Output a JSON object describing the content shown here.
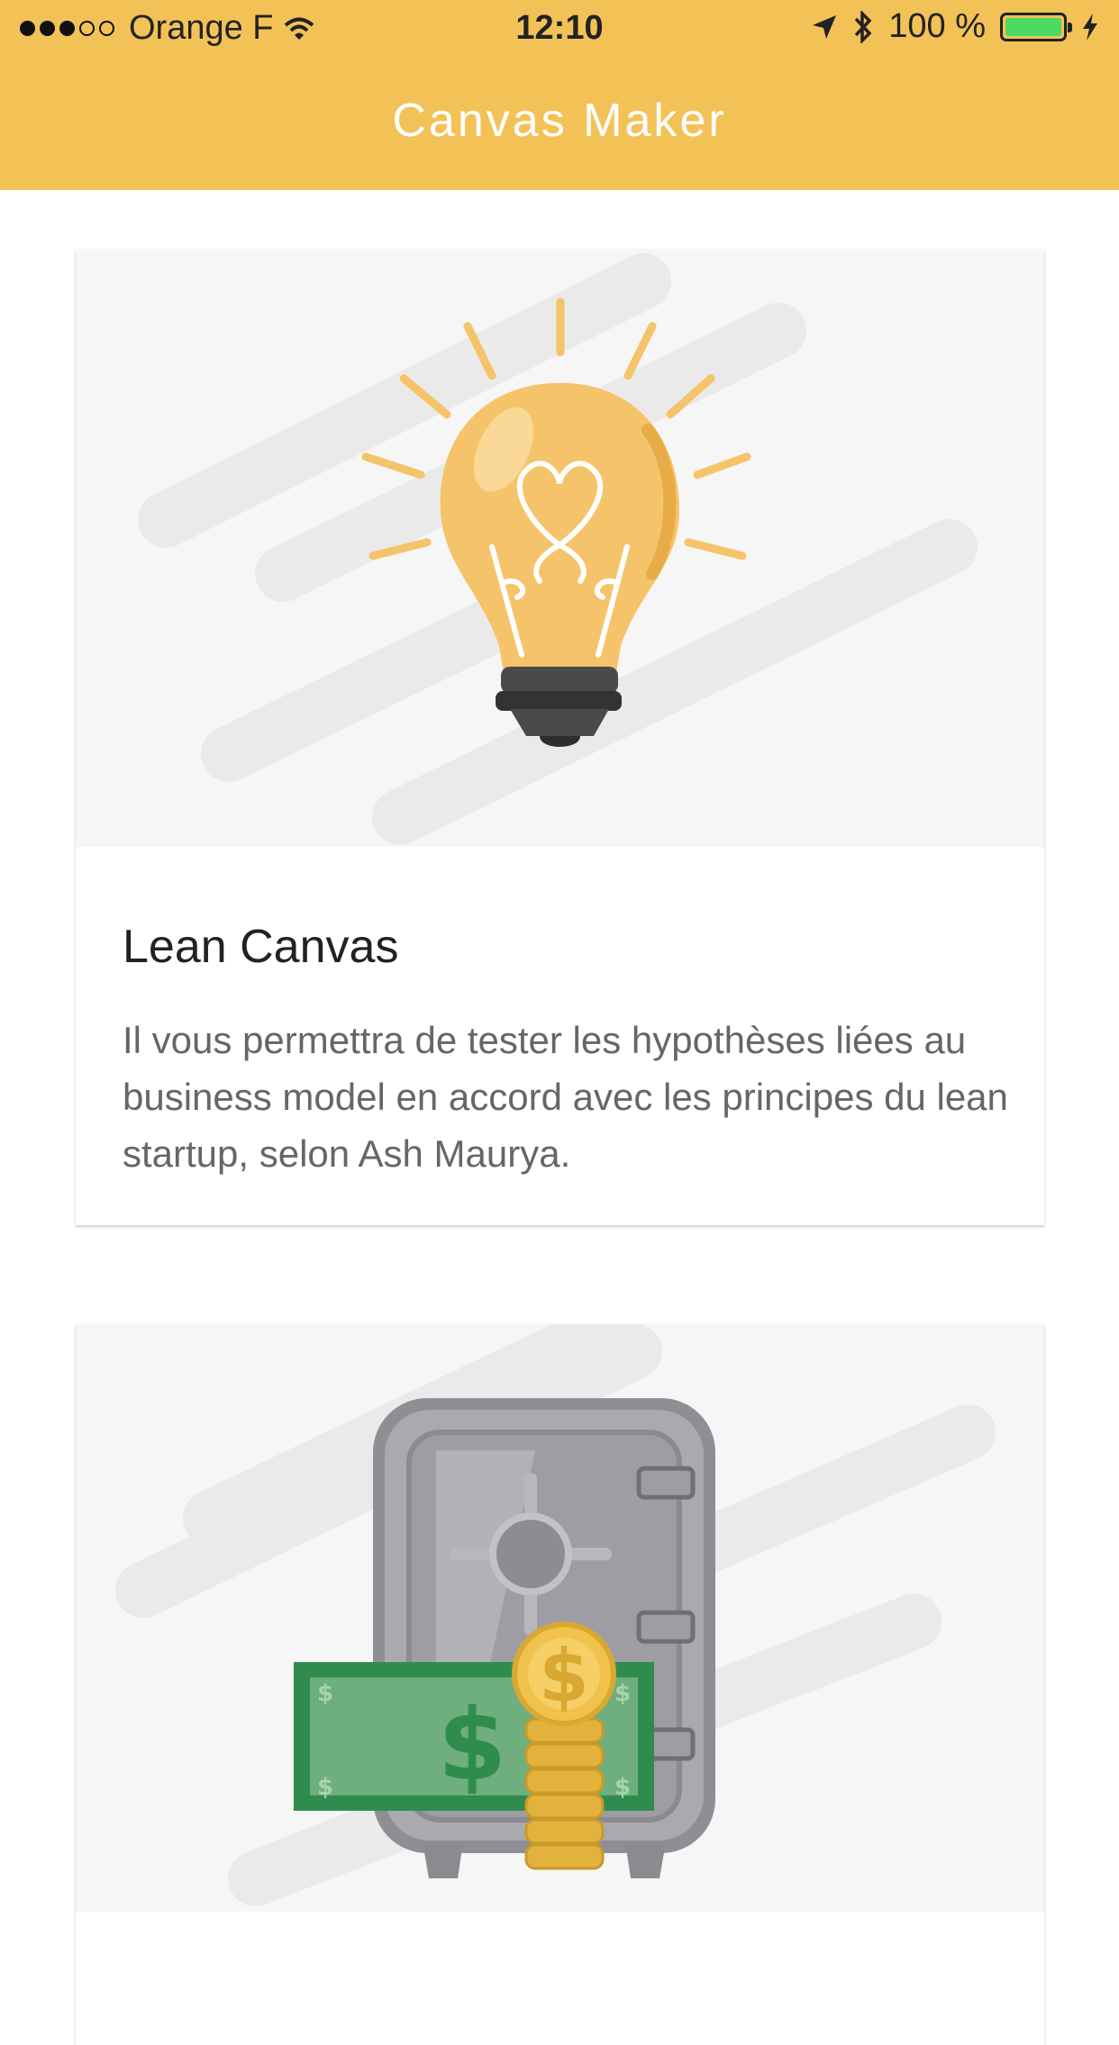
{
  "status_bar": {
    "carrier": "Orange F",
    "time": "12:10",
    "battery": "100 %",
    "signal_icon": "signal-dots-icon",
    "wifi_icon": "wifi-icon",
    "location_icon": "location-arrow-icon",
    "bluetooth_icon": "bluetooth-icon",
    "charging_icon": "charging-bolt-icon"
  },
  "header": {
    "title": "Canvas Maker"
  },
  "cards": [
    {
      "illustration": "lightbulb-illustration",
      "title": "Lean Canvas",
      "description": "Il vous permettra de tester les hypothèses liées au business model en accord avec les principes du lean startup, selon Ash Maurya."
    },
    {
      "illustration": "safe-money-illustration"
    }
  ],
  "colors": {
    "header": "#F3C257",
    "bulb": "#F5C46A",
    "safe": "#9D9DA3",
    "bill": "#2F8C4F",
    "coin": "#E2B23C"
  }
}
